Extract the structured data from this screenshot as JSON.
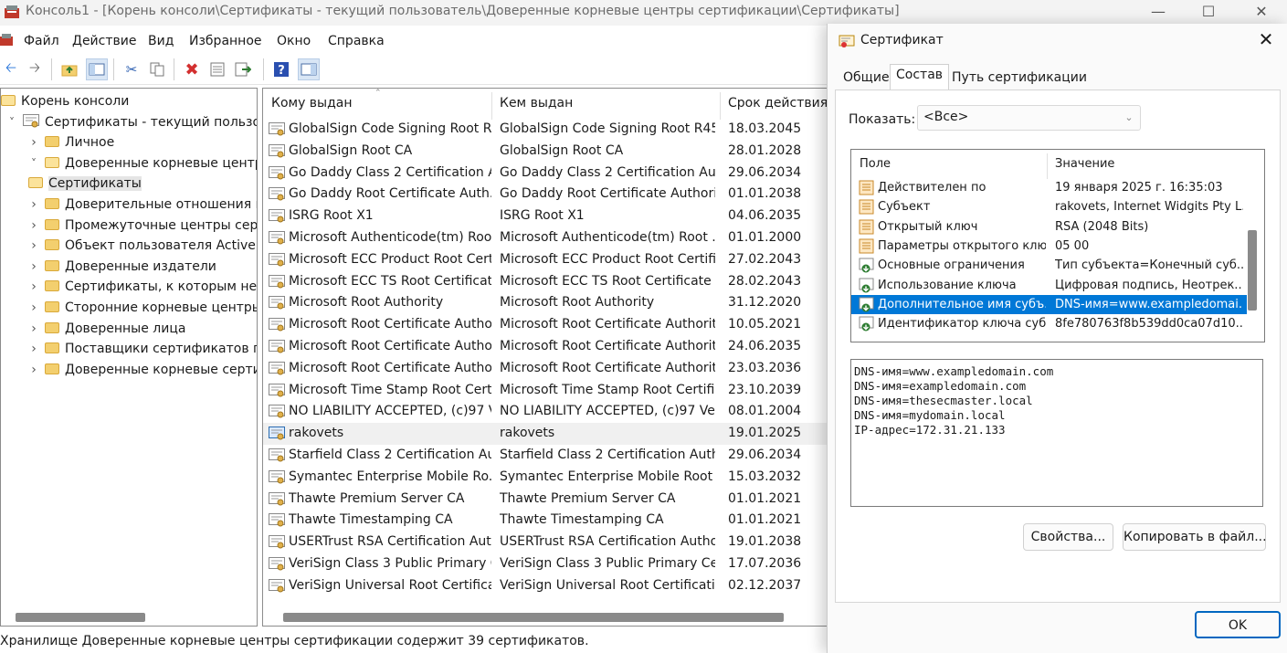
{
  "window": {
    "title": "Консоль1 - [Корень консоли\\Сертификаты - текущий пользователь\\Доверенные корневые центры сертификации\\Сертификаты]"
  },
  "menu": [
    "Файл",
    "Действие",
    "Вид",
    "Избранное",
    "Окно",
    "Справка"
  ],
  "tree": {
    "items": [
      {
        "label": "Корень консоли",
        "level": 0,
        "expanded": true
      },
      {
        "label": "Сертификаты - текущий пользоват",
        "level": 1,
        "expanded": true
      },
      {
        "label": "Личное",
        "level": 2
      },
      {
        "label": "Доверенные корневые центры",
        "level": 2,
        "expanded": true
      },
      {
        "label": "Сертификаты",
        "level": 3,
        "selected": true
      },
      {
        "label": "Доверительные отношения в г",
        "level": 2
      },
      {
        "label": "Промежуточные центры серти",
        "level": 2
      },
      {
        "label": "Объект пользователя Active Dir",
        "level": 2
      },
      {
        "label": "Доверенные издатели",
        "level": 2
      },
      {
        "label": "Сертификаты, к которым нет до",
        "level": 2
      },
      {
        "label": "Сторонние корневые центры с",
        "level": 2
      },
      {
        "label": "Доверенные лица",
        "level": 2
      },
      {
        "label": "Поставщики сертификатов про",
        "level": 2
      },
      {
        "label": "Доверенные корневые сертиф",
        "level": 2
      }
    ]
  },
  "list": {
    "columns": [
      "Кому выдан",
      "Кем выдан",
      "Срок действия"
    ],
    "rows": [
      [
        "GlobalSign Code Signing Root R...",
        "GlobalSign Code Signing Root R45",
        "18.03.2045"
      ],
      [
        "GlobalSign Root CA",
        "GlobalSign Root CA",
        "28.01.2028"
      ],
      [
        "Go Daddy Class 2 Certification A...",
        "Go Daddy Class 2 Certification Aut...",
        "29.06.2034"
      ],
      [
        "Go Daddy Root Certificate Auth...",
        "Go Daddy Root Certificate Authori...",
        "01.01.2038"
      ],
      [
        "ISRG Root X1",
        "ISRG Root X1",
        "04.06.2035"
      ],
      [
        "Microsoft Authenticode(tm) Roo...",
        "Microsoft Authenticode(tm) Root ...",
        "01.01.2000"
      ],
      [
        "Microsoft ECC Product Root Cert...",
        "Microsoft ECC Product Root Certifi...",
        "27.02.2043"
      ],
      [
        "Microsoft ECC TS Root Certificat...",
        "Microsoft ECC TS Root Certificate ...",
        "28.02.2043"
      ],
      [
        "Microsoft Root Authority",
        "Microsoft Root Authority",
        "31.12.2020"
      ],
      [
        "Microsoft Root Certificate Autho...",
        "Microsoft Root Certificate Authority",
        "10.05.2021"
      ],
      [
        "Microsoft Root Certificate Autho...",
        "Microsoft Root Certificate Authorit...",
        "24.06.2035"
      ],
      [
        "Microsoft Root Certificate Autho...",
        "Microsoft Root Certificate Authorit...",
        "23.03.2036"
      ],
      [
        "Microsoft Time Stamp Root Cert...",
        "Microsoft Time Stamp Root Certifi...",
        "23.10.2039"
      ],
      [
        "NO LIABILITY ACCEPTED, (c)97 Ve...",
        "NO LIABILITY ACCEPTED, (c)97 VeriS...",
        "08.01.2004"
      ],
      [
        "rakovets",
        "rakovets",
        "19.01.2025"
      ],
      [
        "Starfield Class 2 Certification Aut...",
        "Starfield Class 2 Certification Auth...",
        "29.06.2034"
      ],
      [
        "Symantec Enterprise Mobile Ro...",
        "Symantec Enterprise Mobile Root f...",
        "15.03.2032"
      ],
      [
        "Thawte Premium Server CA",
        "Thawte Premium Server CA",
        "01.01.2021"
      ],
      [
        "Thawte Timestamping CA",
        "Thawte Timestamping CA",
        "01.01.2021"
      ],
      [
        "USERTrust RSA Certification Auth...",
        "USERTrust RSA Certification Author...",
        "19.01.2038"
      ],
      [
        "VeriSign Class 3 Public Primary C...",
        "VeriSign Class 3 Public Primary Cert...",
        "17.07.2036"
      ],
      [
        "VeriSign Universal Root Certifica...",
        "VeriSign Universal Root Certificatio...",
        "02.12.2037"
      ]
    ],
    "hover_row": 14
  },
  "status": "Хранилище Доверенные корневые центры сертификации содержит 39 сертификатов.",
  "dialog": {
    "title": "Сертификат",
    "tabs": [
      "Общие",
      "Состав",
      "Путь сертификации"
    ],
    "active_tab": 1,
    "show_label": "Показать:",
    "show_value": "<Все>",
    "columns": [
      "Поле",
      "Значение"
    ],
    "fields": [
      {
        "name": "Действителен по",
        "value": "19 января 2025 г. 16:35:03",
        "icon": "doc-icon"
      },
      {
        "name": "Субъект",
        "value": "rakovets, Internet Widgits Pty L...",
        "icon": "doc-icon"
      },
      {
        "name": "Открытый ключ",
        "value": "RSA (2048 Bits)",
        "icon": "doc-icon"
      },
      {
        "name": "Параметры открытого клю...",
        "value": "05 00",
        "icon": "doc-icon"
      },
      {
        "name": "Основные ограничения",
        "value": "Тип субъекта=Конечный суб...",
        "icon": "extension-icon"
      },
      {
        "name": "Использование ключа",
        "value": "Цифровая подпись, Неотрек...",
        "icon": "extension-icon"
      },
      {
        "name": "Дополнительное имя субъ...",
        "value": "DNS-имя=www.exampledomai...",
        "icon": "extension-icon",
        "selected": true
      },
      {
        "name": "Идентификатор ключа суб...",
        "value": "8fe780763f8b539dd0ca07d10...",
        "icon": "extension-icon"
      }
    ],
    "detail": "DNS-имя=www.exampledomain.com\nDNS-имя=exampledomain.com\nDNS-имя=thesecmaster.local\nDNS-имя=mydomain.local\nIP-адрес=172.31.21.133",
    "properties_button": "Свойства...",
    "copy_button": "Копировать в файл...",
    "ok_button": "OK"
  }
}
